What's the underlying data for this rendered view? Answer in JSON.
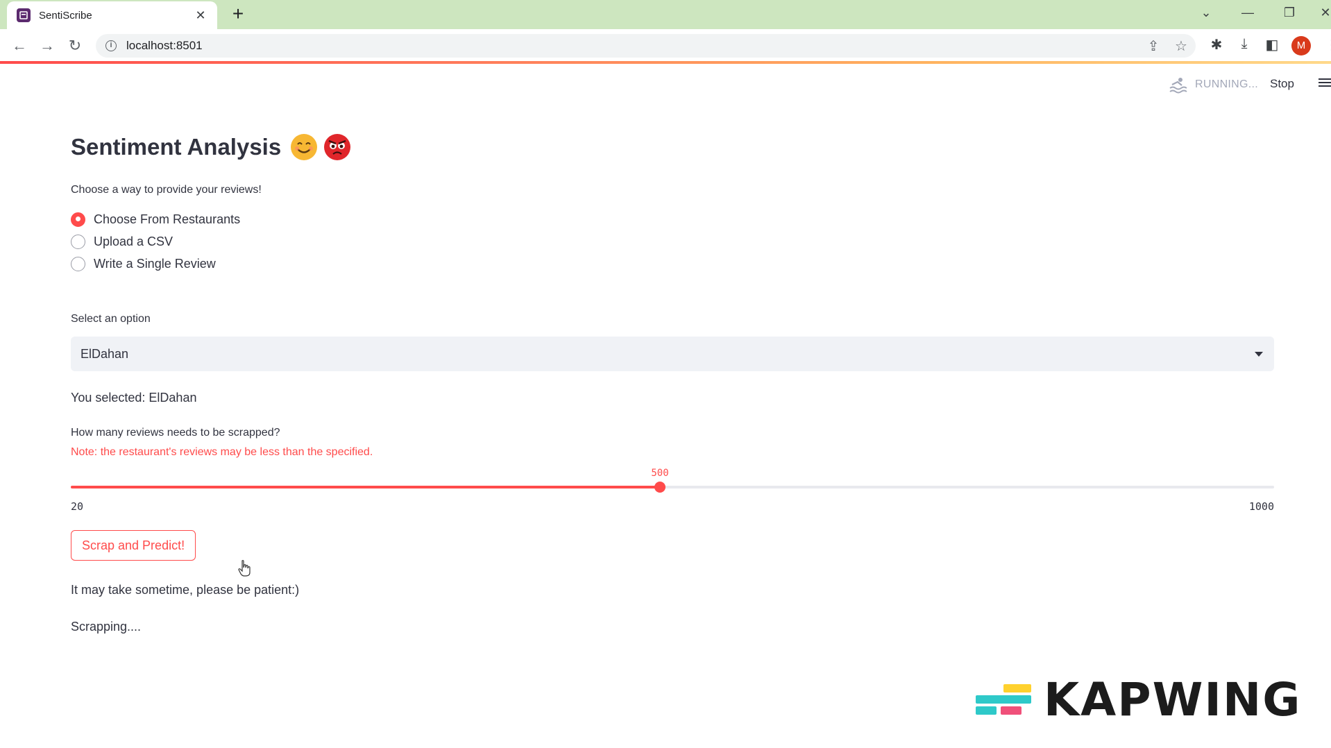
{
  "browser": {
    "tab_title": "SentiScribe",
    "new_tab_symbol": "+",
    "url": "localhost:8501",
    "profile_initial": "M"
  },
  "streamlit": {
    "status": "RUNNING...",
    "stop_label": "Stop"
  },
  "main": {
    "title": "Sentiment Analysis",
    "title_emojis": [
      "smiling-face-icon",
      "angry-face-icon"
    ],
    "choose_caption": "Choose a way to provide your reviews!",
    "radio_options": [
      {
        "label": "Choose From Restaurants",
        "checked": true
      },
      {
        "label": "Upload a CSV",
        "checked": false
      },
      {
        "label": "Write a Single Review",
        "checked": false
      }
    ],
    "select_label": "Select an option",
    "select_value": "ElDahan",
    "selected_text": "You selected: ElDahan",
    "slider_label": "How many reviews needs to be scrapped?",
    "slider_note": "Note: the restaurant's reviews may be less than the specified.",
    "slider": {
      "min": 20,
      "max": 1000,
      "value": 500,
      "min_label": "20",
      "max_label": "1000",
      "value_label": "500"
    },
    "button_label": "Scrap and Predict!",
    "patience_text": "It may take sometime, please be patient:)",
    "status_text": "Scrapping...."
  },
  "watermark": {
    "text": "KAPWING"
  },
  "colors": {
    "accent": "#ff4b4b",
    "tabbar": "#cde6bf",
    "text": "#31333f",
    "select_bg": "#f0f2f6"
  }
}
